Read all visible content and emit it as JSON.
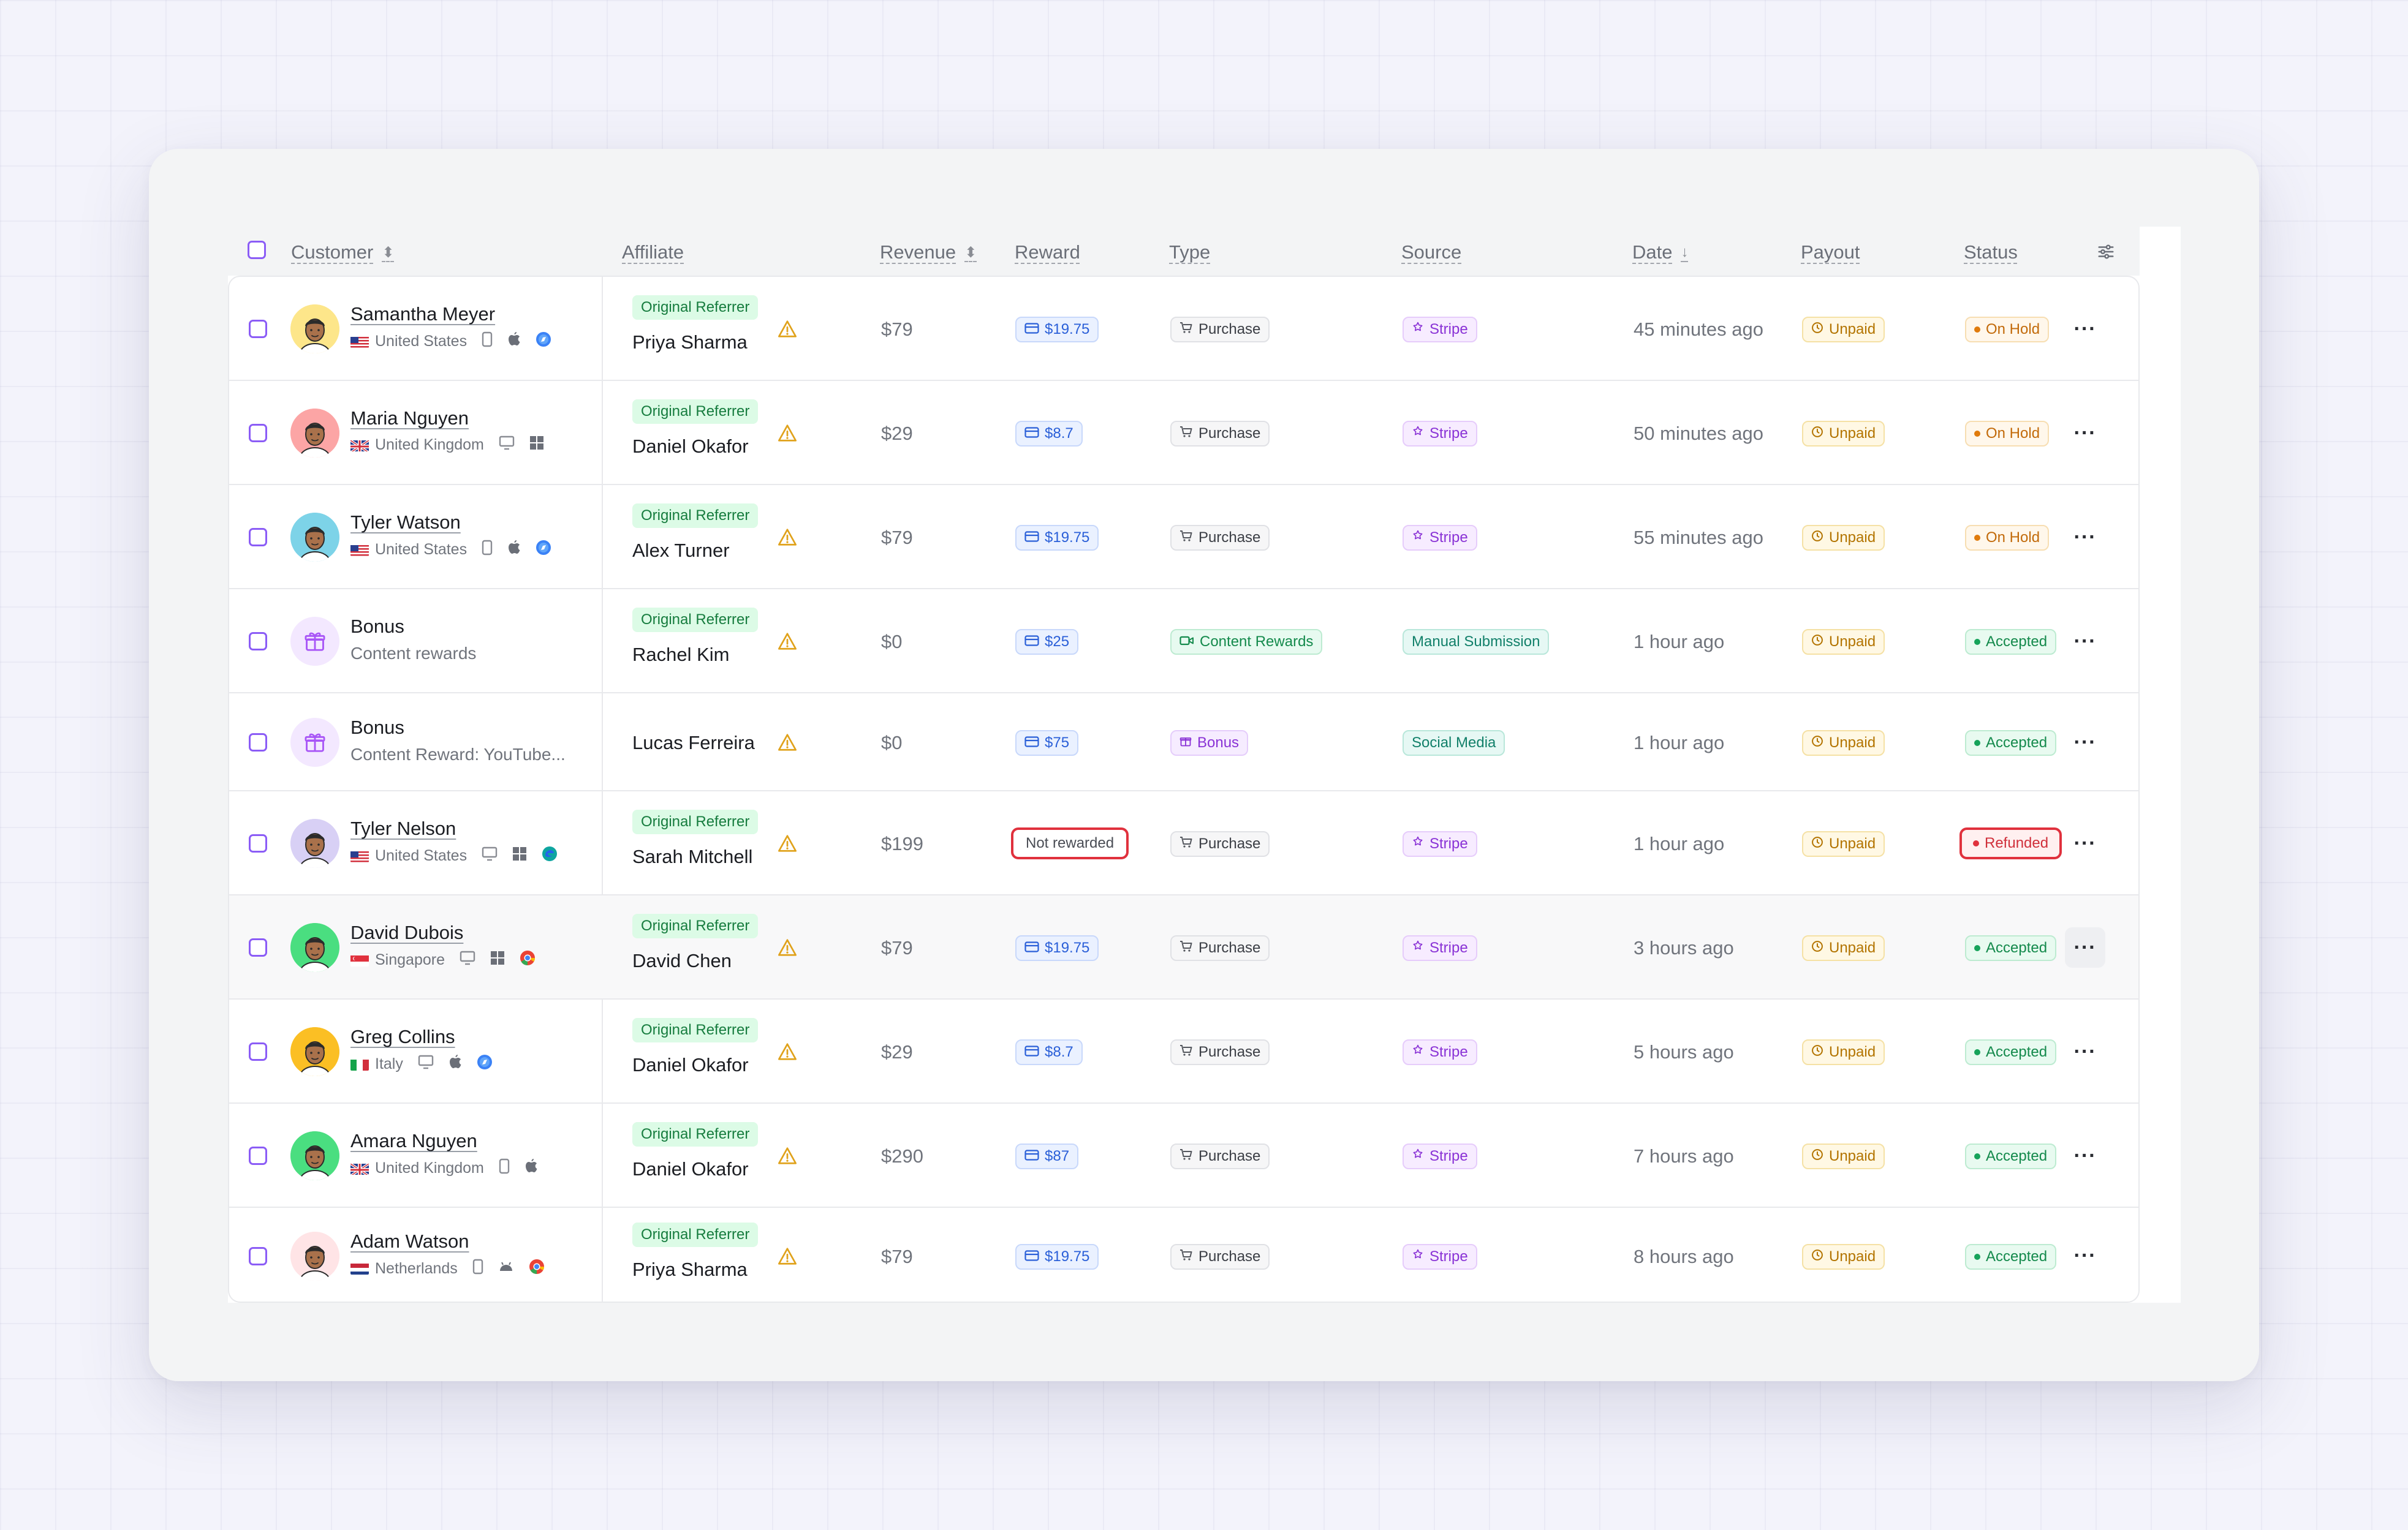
{
  "header": {
    "customer": "Customer",
    "affiliate": "Affiliate",
    "revenue": "Revenue",
    "reward": "Reward",
    "type": "Type",
    "source": "Source",
    "date": "Date",
    "payout": "Payout",
    "status": "Status"
  },
  "rows": [
    {
      "name": "Samantha Meyer",
      "sub": "United States",
      "flag": "us",
      "devices": [
        "mobile",
        "apple",
        "safari"
      ],
      "avatar_bg": "#fde68a",
      "referrer": "Original Referrer",
      "affiliate": "Priya Sharma",
      "revenue": "$79",
      "reward": "$19.75",
      "type": "Purchase",
      "source": "Stripe",
      "date": "45 minutes ago",
      "payout": "Unpaid",
      "status": "On Hold"
    },
    {
      "name": "Maria Nguyen",
      "sub": "United Kingdom",
      "flag": "uk",
      "devices": [
        "desktop",
        "windows"
      ],
      "avatar_bg": "#fca5a5",
      "referrer": "Original Referrer",
      "affiliate": "Daniel Okafor",
      "revenue": "$29",
      "reward": "$8.7",
      "type": "Purchase",
      "source": "Stripe",
      "date": "50 minutes ago",
      "payout": "Unpaid",
      "status": "On Hold"
    },
    {
      "name": "Tyler Watson",
      "sub": "United States",
      "flag": "us",
      "devices": [
        "mobile",
        "apple",
        "safari"
      ],
      "avatar_bg": "#7dd3e8",
      "referrer": "Original Referrer",
      "affiliate": "Alex Turner",
      "revenue": "$79",
      "reward": "$19.75",
      "type": "Purchase",
      "source": "Stripe",
      "date": "55 minutes ago",
      "payout": "Unpaid",
      "status": "On Hold"
    },
    {
      "name": "Bonus",
      "sub": "Content rewards",
      "flag": "",
      "devices": [],
      "avatar_bg": "#f3e8ff",
      "referrer": "Original Referrer",
      "affiliate": "Rachel Kim",
      "revenue": "$0",
      "reward": "$25",
      "type": "Content Rewards",
      "source": "Manual Submission",
      "date": "1 hour ago",
      "payout": "Unpaid",
      "status": "Accepted"
    },
    {
      "name": "Bonus",
      "sub": "Content Reward: YouTube...",
      "flag": "",
      "devices": [],
      "avatar_bg": "#f3e8ff",
      "referrer": "",
      "affiliate": "Lucas Ferreira",
      "revenue": "$0",
      "reward": "$75",
      "type": "Bonus",
      "source": "Social Media",
      "date": "1 hour ago",
      "payout": "Unpaid",
      "status": "Accepted"
    },
    {
      "name": "Tyler Nelson",
      "sub": "United States",
      "flag": "us",
      "devices": [
        "desktop",
        "windows",
        "edge"
      ],
      "avatar_bg": "#d8d0f5",
      "referrer": "Original Referrer",
      "affiliate": "Sarah Mitchell",
      "revenue": "$199",
      "reward": "Not rewarded",
      "type": "Purchase",
      "source": "Stripe",
      "date": "1 hour ago",
      "payout": "Unpaid",
      "status": "Refunded"
    },
    {
      "name": "David Dubois",
      "sub": "Singapore",
      "flag": "sg",
      "devices": [
        "desktop",
        "windows",
        "chrome"
      ],
      "avatar_bg": "#4ade80",
      "referrer": "Original Referrer",
      "affiliate": "David Chen",
      "revenue": "$79",
      "reward": "$19.75",
      "type": "Purchase",
      "source": "Stripe",
      "date": "3 hours ago",
      "payout": "Unpaid",
      "status": "Accepted"
    },
    {
      "name": "Greg Collins",
      "sub": "Italy",
      "flag": "it",
      "devices": [
        "desktop",
        "apple",
        "safari"
      ],
      "avatar_bg": "#fbbf24",
      "referrer": "Original Referrer",
      "affiliate": "Daniel Okafor",
      "revenue": "$29",
      "reward": "$8.7",
      "type": "Purchase",
      "source": "Stripe",
      "date": "5 hours ago",
      "payout": "Unpaid",
      "status": "Accepted"
    },
    {
      "name": "Amara Nguyen",
      "sub": "United Kingdom",
      "flag": "uk",
      "devices": [
        "mobile",
        "apple"
      ],
      "avatar_bg": "#4ade80",
      "referrer": "Original Referrer",
      "affiliate": "Daniel Okafor",
      "revenue": "$290",
      "reward": "$87",
      "type": "Purchase",
      "source": "Stripe",
      "date": "7 hours ago",
      "payout": "Unpaid",
      "status": "Accepted"
    },
    {
      "name": "Adam Watson",
      "sub": "Netherlands",
      "flag": "nl",
      "devices": [
        "mobile",
        "android",
        "chrome"
      ],
      "avatar_bg": "#ffe4e6",
      "referrer": "Original Referrer",
      "affiliate": "Priya Sharma",
      "revenue": "$79",
      "reward": "$19.75",
      "type": "Purchase",
      "source": "Stripe",
      "date": "8 hours ago",
      "payout": "Unpaid",
      "status": "Accepted"
    }
  ]
}
